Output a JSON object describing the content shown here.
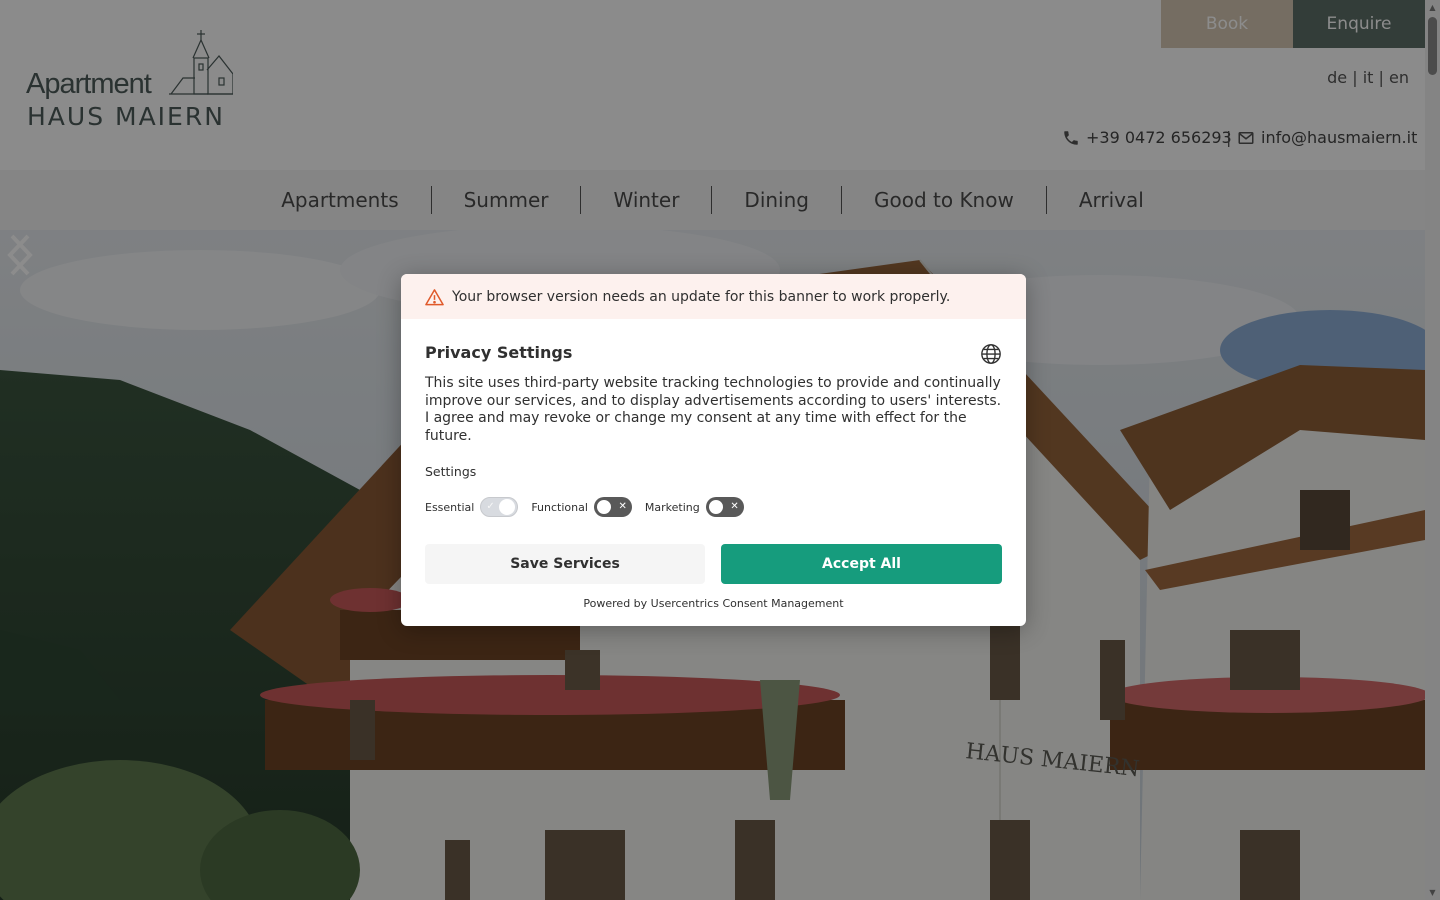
{
  "header": {
    "logo_script": "Apartment",
    "logo_name": "HAUS MAIERN",
    "book_label": "Book",
    "enquire_label": "Enquire",
    "languages": [
      "de",
      "it",
      "en"
    ],
    "phone": "+39 0472 656293",
    "email": "info@hausmaiern.it"
  },
  "nav": {
    "items": [
      "Apartments",
      "Summer",
      "Winter",
      "Dining",
      "Good to Know",
      "Arrival"
    ]
  },
  "hero": {
    "sign_text": "HAUS MAIERN"
  },
  "consent": {
    "warning": "Your browser version needs an update for this banner to work properly.",
    "title": "Privacy Settings",
    "description": "This site uses third-party website tracking technologies to provide and continually improve our services, and to display advertisements according to users' interests. I agree and may revoke or change my consent at any time with effect for the future.",
    "settings_label": "Settings",
    "toggles": [
      {
        "label": "Essential",
        "state": "on"
      },
      {
        "label": "Functional",
        "state": "off"
      },
      {
        "label": "Marketing",
        "state": "off"
      }
    ],
    "save_label": "Save Services",
    "accept_label": "Accept All",
    "powered_by": "Powered by Usercentrics Consent Management"
  },
  "colors": {
    "accent": "#169c7d",
    "book_bg": "#d5c7b3",
    "enquire_bg": "#5d6f69",
    "warning_bg": "#fdf1ee",
    "warning_icon": "#e05a2b"
  }
}
